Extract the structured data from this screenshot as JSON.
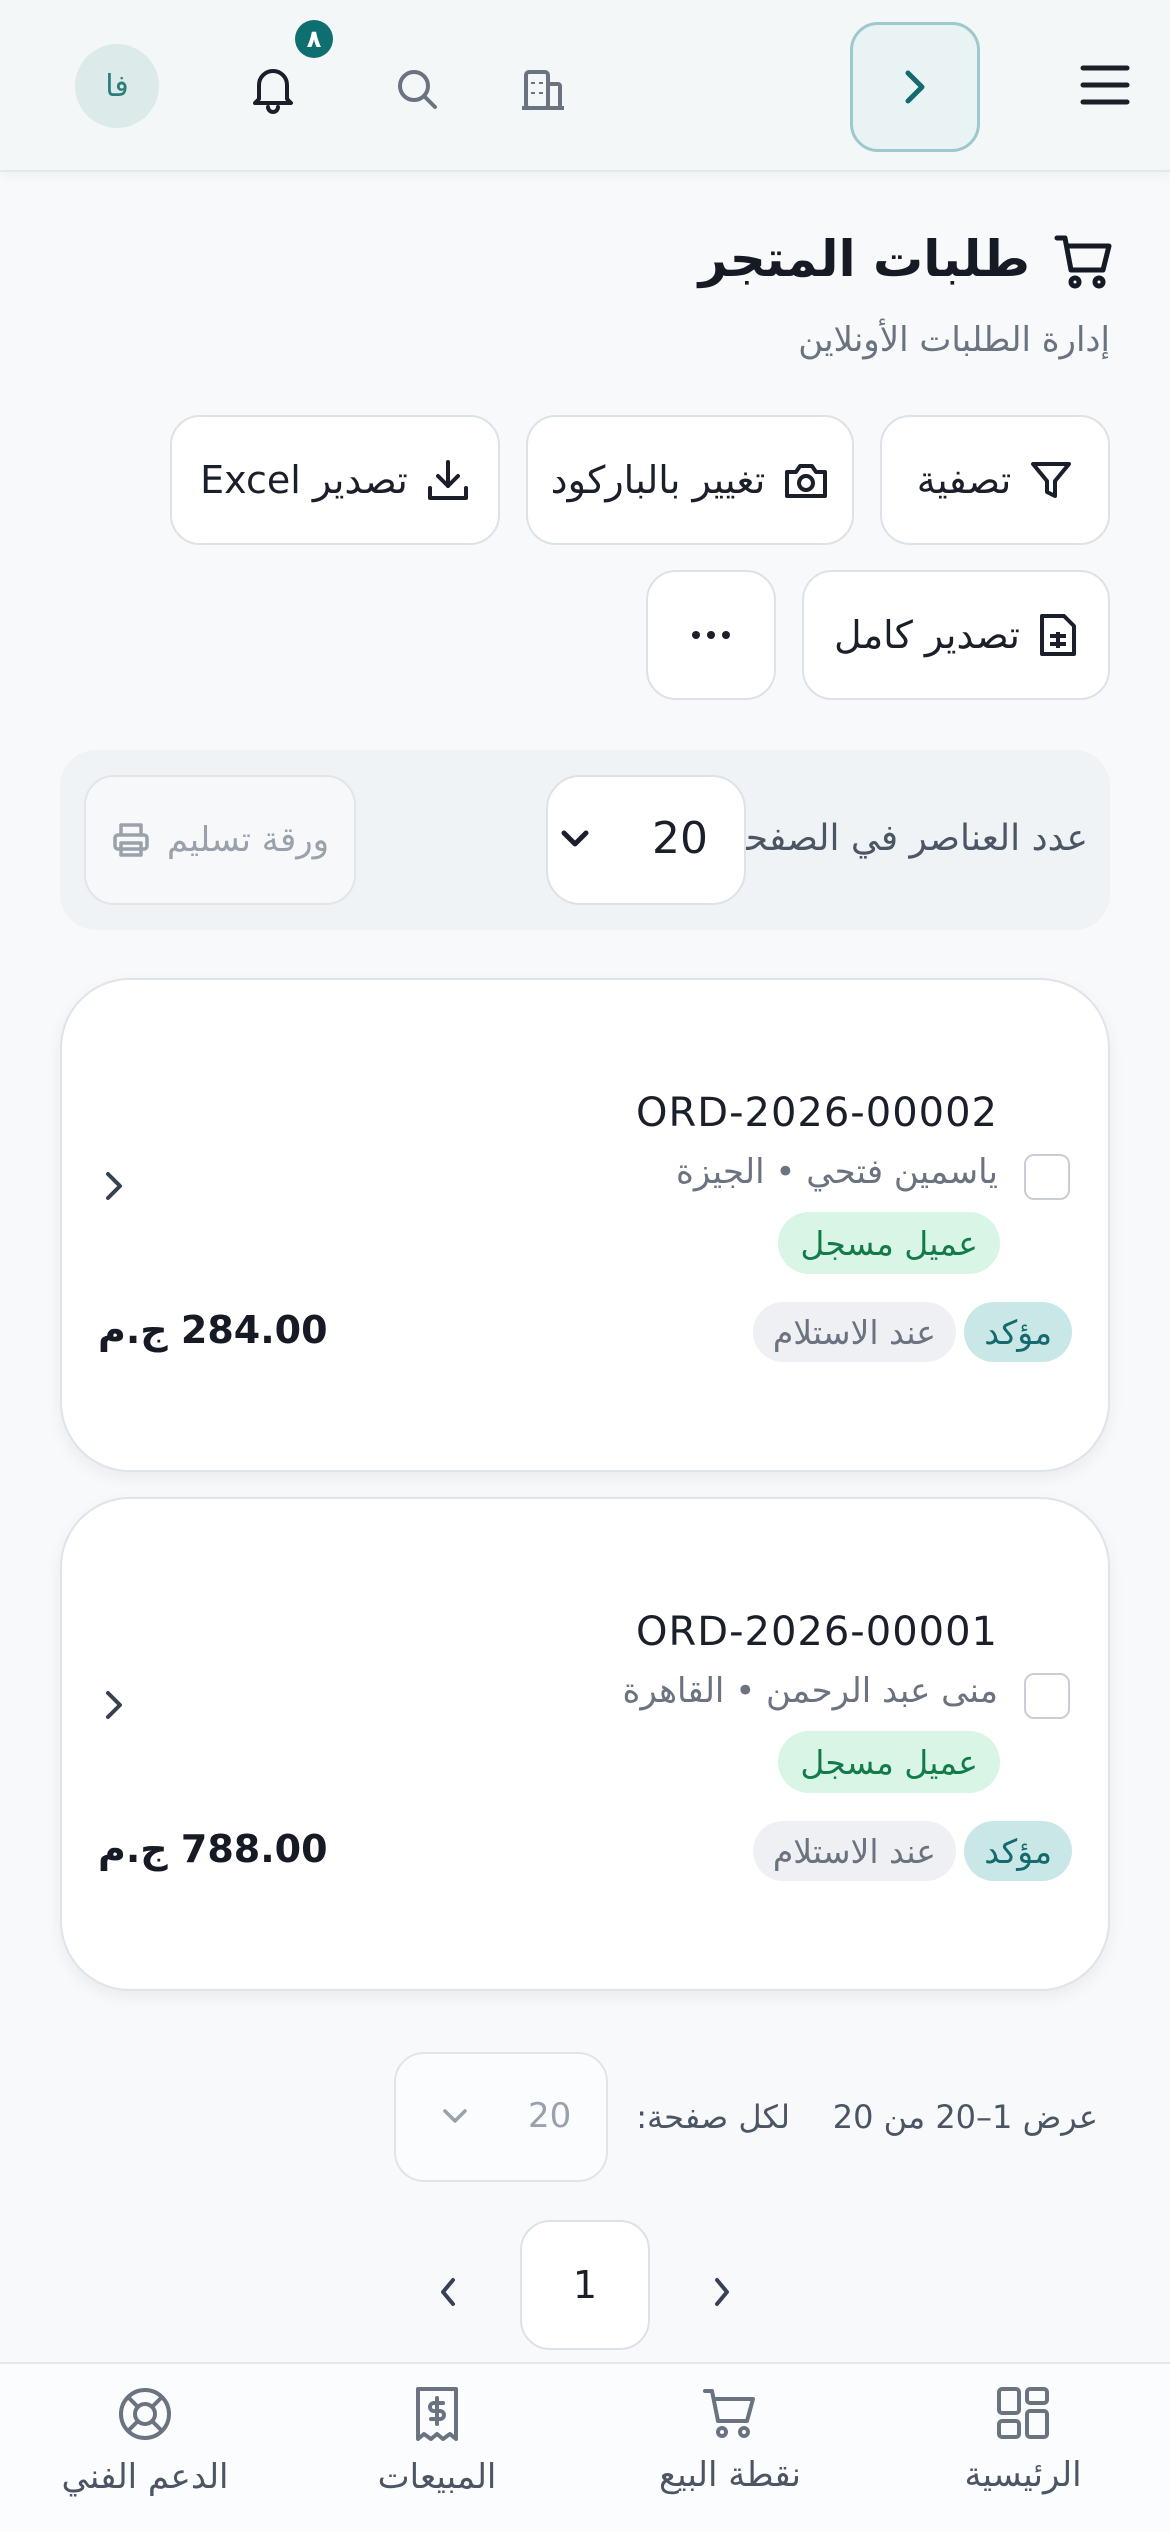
{
  "topbar": {
    "notifications_count": "٨",
    "avatar_initials": "فا"
  },
  "header": {
    "title": "طلبات المتجر",
    "subtitle": "إدارة الطلبات الأونلاين"
  },
  "actions": {
    "filter_label": "تصفية",
    "barcode_label": "تغيير بالباركود",
    "excel_label": "تصدير Excel",
    "full_export_label": "تصدير كامل",
    "more_label": "···"
  },
  "page_size": {
    "label": "عدد العناصر في الصفحة:",
    "value": "20",
    "delivery_slip_label": "ورقة تسليم"
  },
  "orders": [
    {
      "number": "ORD-2026-00002",
      "customer": "ياسمين فتحي • الجيزة",
      "customer_type": "عميل مسجل",
      "status": "مؤكد",
      "payment": "عند الاستلام",
      "total": "284.00 ج.م"
    },
    {
      "number": "ORD-2026-00001",
      "customer": "منى عبد الرحمن • القاهرة",
      "customer_type": "عميل مسجل",
      "status": "مؤكد",
      "payment": "عند الاستلام",
      "total": "788.00 ج.م"
    }
  ],
  "pagination": {
    "info": "عرض 1–20 من 20",
    "per_page_label": "لكل صفحة:",
    "per_page_value": "20",
    "current_page": "1"
  },
  "bottom_nav": {
    "home": "الرئيسية",
    "pos": "نقطة البيع",
    "sales": "المبيعات",
    "support": "الدعم الفني"
  },
  "colors": {
    "accent": "#0f6e70",
    "badge_green_bg": "#d8f5e6",
    "status_bg": "#c8e7e6"
  }
}
